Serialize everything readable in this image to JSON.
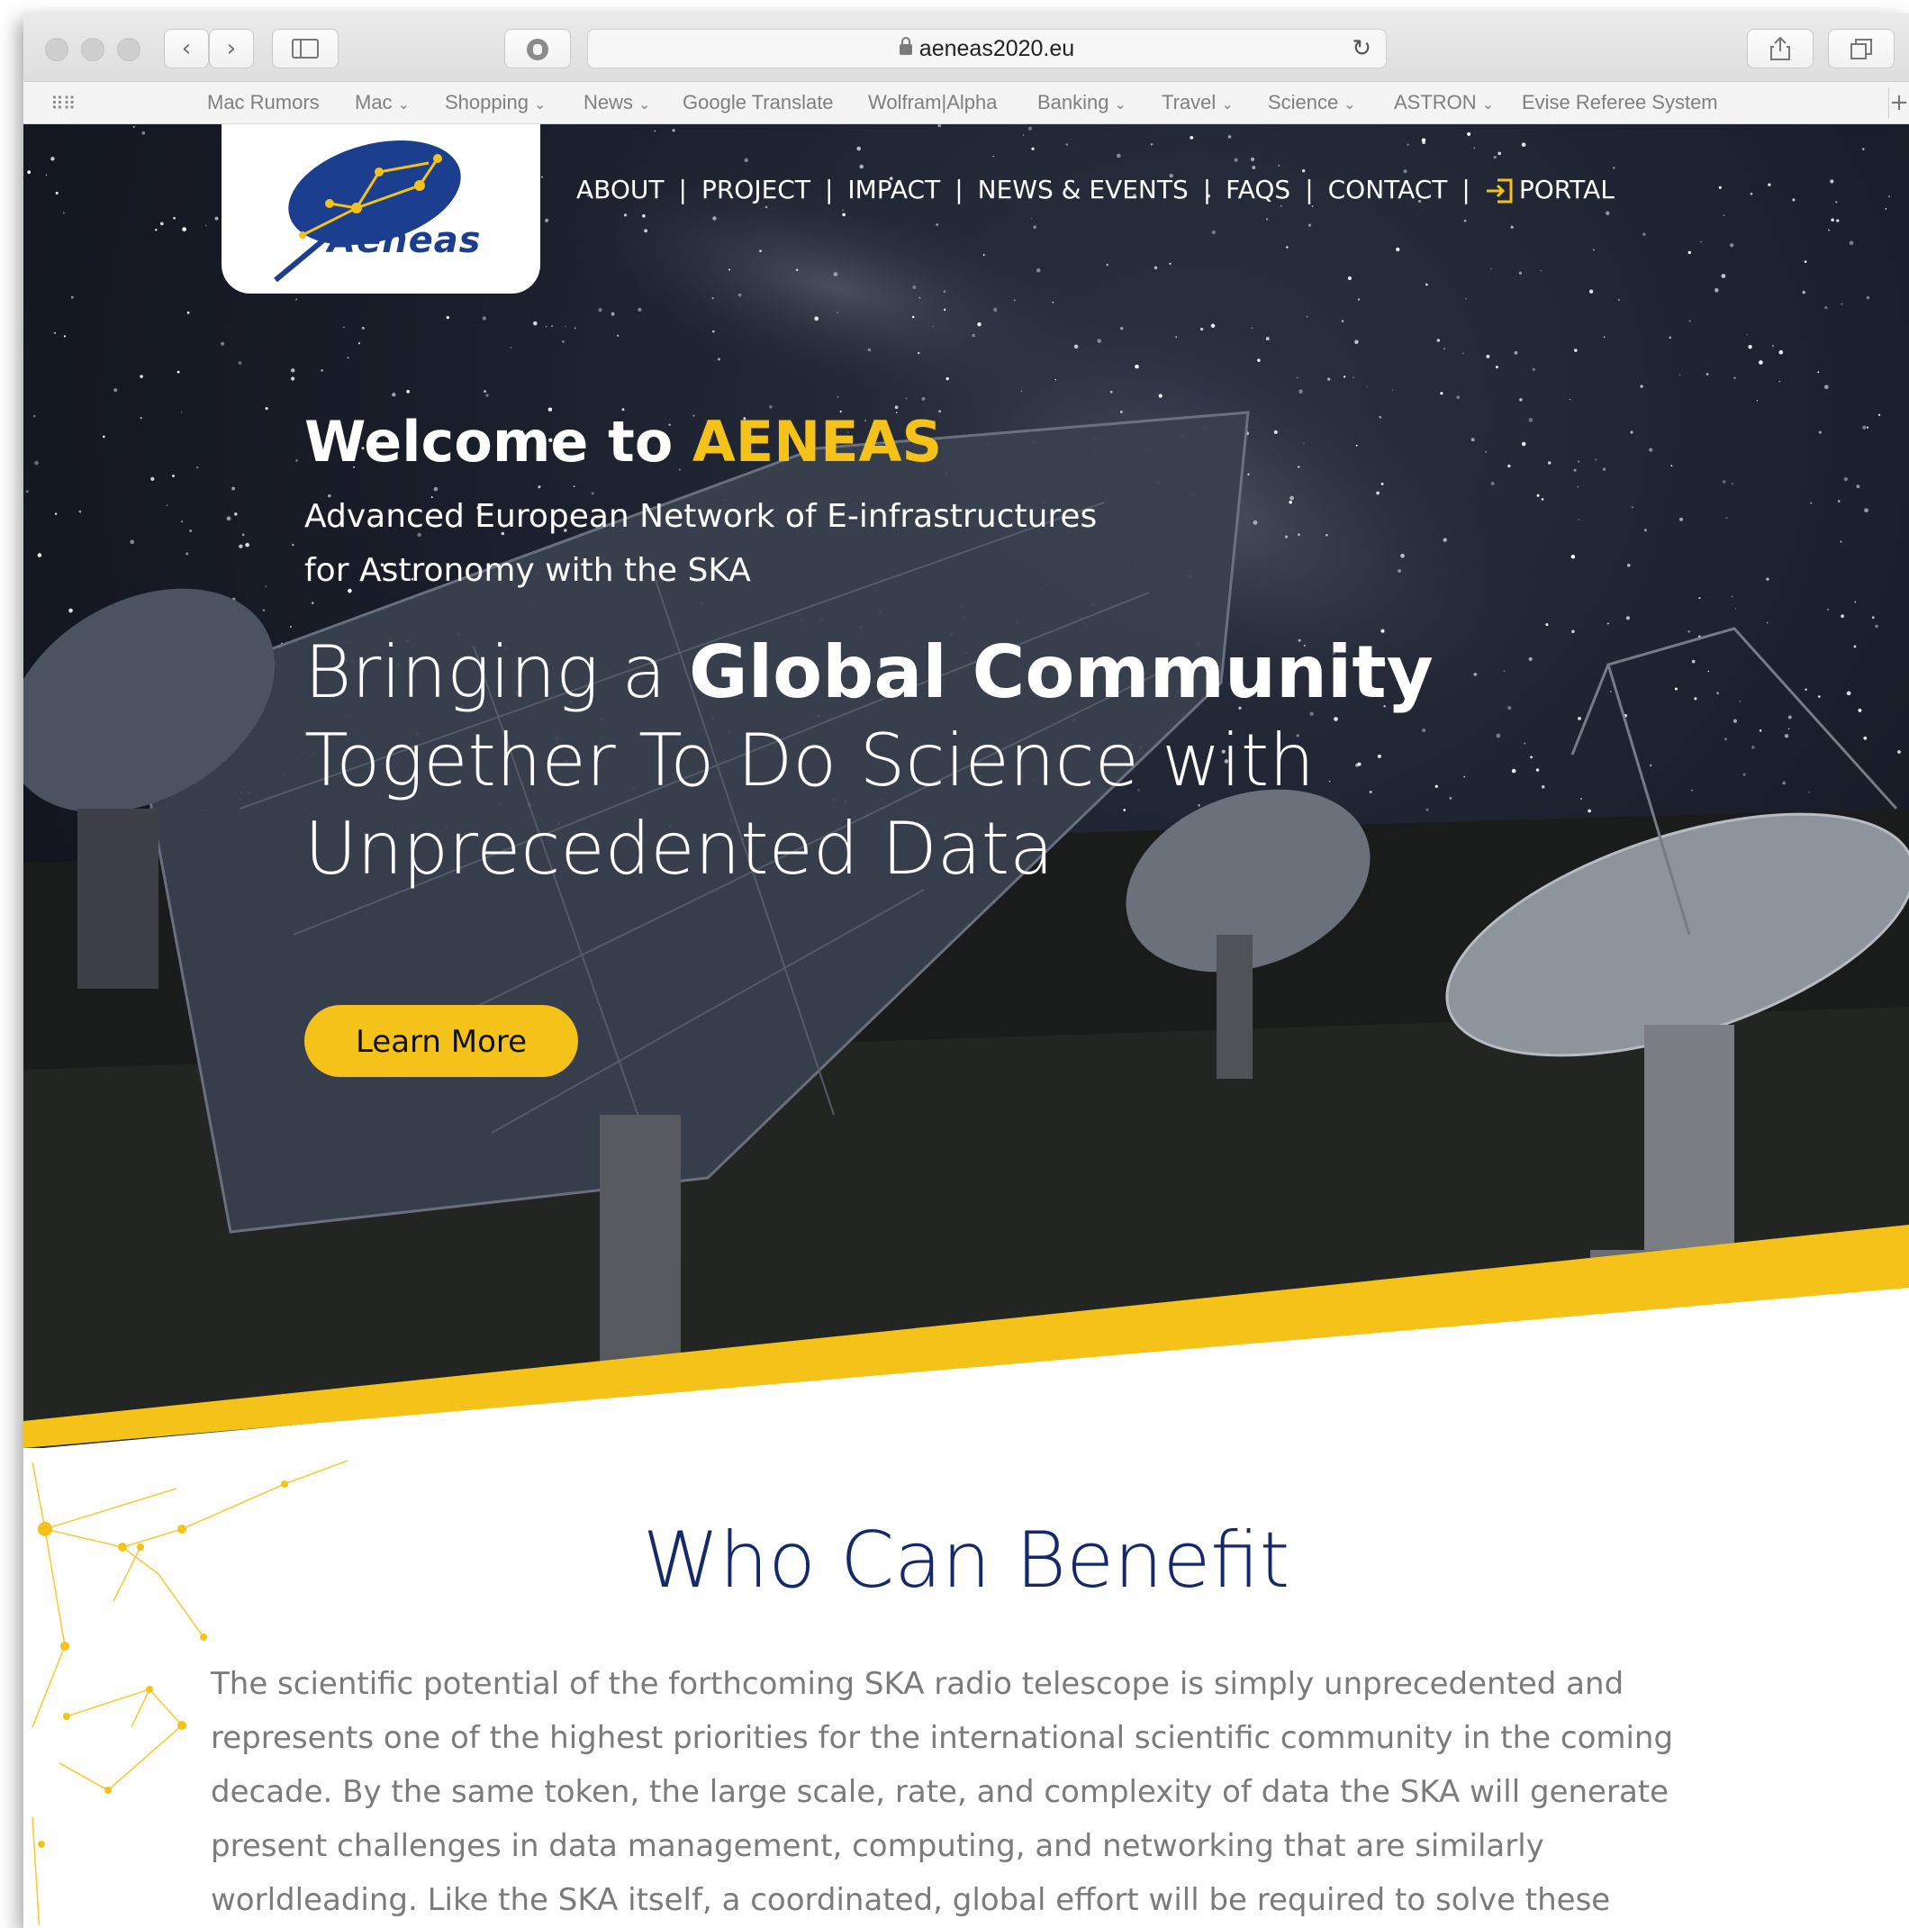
{
  "browser": {
    "url": "aeneas2020.eu",
    "bookmarks": [
      {
        "label": "Mac Rumors",
        "dropdown": false
      },
      {
        "label": "Mac",
        "dropdown": true
      },
      {
        "label": "Shopping",
        "dropdown": true
      },
      {
        "label": "News",
        "dropdown": true
      },
      {
        "label": "Google Translate",
        "dropdown": false
      },
      {
        "label": "Wolfram|Alpha",
        "dropdown": false
      },
      {
        "label": "Banking",
        "dropdown": true
      },
      {
        "label": "Travel",
        "dropdown": true
      },
      {
        "label": "Science",
        "dropdown": true
      },
      {
        "label": "ASTRON",
        "dropdown": true
      },
      {
        "label": "Evise Referee System",
        "dropdown": false
      }
    ]
  },
  "site": {
    "logo_text": "Aeneas",
    "nav": [
      "ABOUT",
      "PROJECT",
      "IMPACT",
      "NEWS & EVENTS",
      "FAQS",
      "CONTACT"
    ],
    "nav_portal": "PORTAL",
    "accent_color": "#f5c21a",
    "brand_color": "#13296a"
  },
  "hero": {
    "welcome": "Welcome to ",
    "welcome_accent": "AENEAS",
    "subtitle_line1": "Advanced European Network of E-infrastructures",
    "subtitle_line2": "for Astronomy with the SKA",
    "tagline_pre": "Bringing a ",
    "tagline_bold": "Global Community",
    "tagline_line2": "Together To Do Science with",
    "tagline_line3": "Unprecedented Data",
    "cta": "Learn More"
  },
  "benefit": {
    "title": "Who Can Benefit",
    "text": "The scientific potential of the forthcoming SKA radio telescope is simply unprecedented and represents one of the highest priorities for the international scientific community in the coming decade. By the same token, the large scale, rate, and complexity of data the SKA will generate present challenges in data management, computing, and networking that are similarly worldleading. Like the SKA itself, a coordinated, global effort will be required to solve these challenges and fully"
  }
}
